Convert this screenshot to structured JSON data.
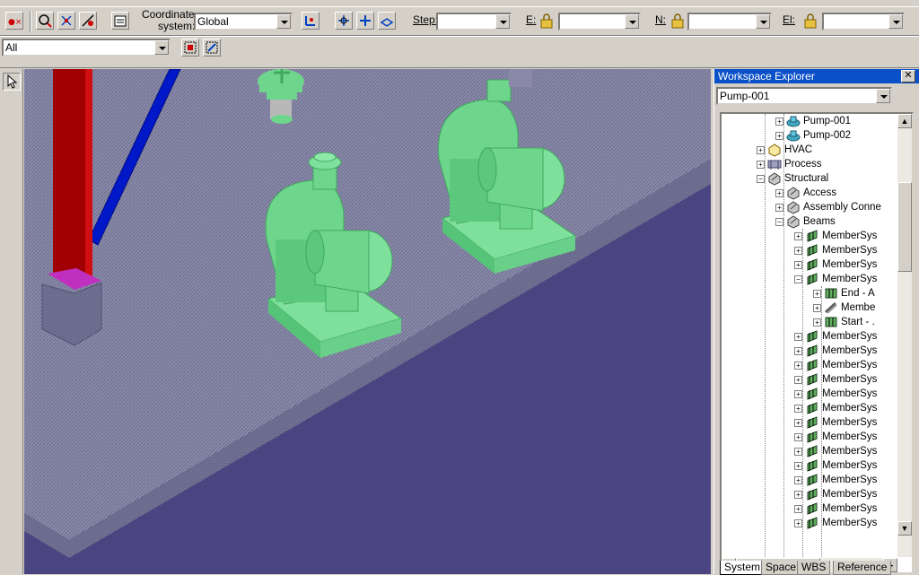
{
  "toolbar": {
    "coordinate_label_line1": "Coordinate",
    "coordinate_label_line2": "system:",
    "coordinate_value": "Global",
    "step_label": "Step:",
    "step_value": "",
    "e_label": "E:",
    "e_value": "",
    "n_label": "N:",
    "n_value": "",
    "el_label": "El:",
    "el_value": "",
    "filter_value": "All"
  },
  "explorer": {
    "title": "Workspace Explorer",
    "close": "✕",
    "selected": "Pump-001",
    "tree": [
      {
        "label": "Pump-001",
        "indent": 4,
        "expander": "+",
        "icon": "pump-icon"
      },
      {
        "label": "Pump-002",
        "indent": 4,
        "expander": "+",
        "icon": "pump-icon"
      },
      {
        "label": "HVAC",
        "indent": 3,
        "expander": "+",
        "icon": "hvac-icon"
      },
      {
        "label": "Process",
        "indent": 3,
        "expander": "+",
        "icon": "process-icon"
      },
      {
        "label": "Structural",
        "indent": 3,
        "expander": "−",
        "icon": "structural-icon"
      },
      {
        "label": "Access",
        "indent": 4,
        "expander": "+",
        "icon": "structural-icon"
      },
      {
        "label": "Assembly Conne",
        "indent": 4,
        "expander": "+",
        "icon": "structural-icon"
      },
      {
        "label": "Beams",
        "indent": 4,
        "expander": "−",
        "icon": "structural-icon"
      },
      {
        "label": "MemberSys",
        "indent": 5,
        "expander": "+",
        "icon": "member-icon"
      },
      {
        "label": "MemberSys",
        "indent": 5,
        "expander": "+",
        "icon": "member-icon"
      },
      {
        "label": "MemberSys",
        "indent": 5,
        "expander": "+",
        "icon": "member-icon"
      },
      {
        "label": "MemberSys",
        "indent": 5,
        "expander": "−",
        "icon": "member-icon"
      },
      {
        "label": "End - A",
        "indent": 6,
        "expander": "+",
        "icon": "end-icon"
      },
      {
        "label": "Membe",
        "indent": 6,
        "expander": "+",
        "icon": "member-part-icon"
      },
      {
        "label": "Start - .",
        "indent": 6,
        "expander": "+",
        "icon": "end-icon"
      },
      {
        "label": "MemberSys",
        "indent": 5,
        "expander": "+",
        "icon": "member-icon"
      },
      {
        "label": "MemberSys",
        "indent": 5,
        "expander": "+",
        "icon": "member-icon"
      },
      {
        "label": "MemberSys",
        "indent": 5,
        "expander": "+",
        "icon": "member-icon"
      },
      {
        "label": "MemberSys",
        "indent": 5,
        "expander": "+",
        "icon": "member-icon"
      },
      {
        "label": "MemberSys",
        "indent": 5,
        "expander": "+",
        "icon": "member-icon"
      },
      {
        "label": "MemberSys",
        "indent": 5,
        "expander": "+",
        "icon": "member-icon"
      },
      {
        "label": "MemberSys",
        "indent": 5,
        "expander": "+",
        "icon": "member-icon"
      },
      {
        "label": "MemberSys",
        "indent": 5,
        "expander": "+",
        "icon": "member-icon"
      },
      {
        "label": "MemberSys",
        "indent": 5,
        "expander": "+",
        "icon": "member-icon"
      },
      {
        "label": "MemberSys",
        "indent": 5,
        "expander": "+",
        "icon": "member-icon"
      },
      {
        "label": "MemberSys",
        "indent": 5,
        "expander": "+",
        "icon": "member-icon"
      },
      {
        "label": "MemberSys",
        "indent": 5,
        "expander": "+",
        "icon": "member-icon"
      },
      {
        "label": "MemberSys",
        "indent": 5,
        "expander": "+",
        "icon": "member-icon"
      },
      {
        "label": "MemberSys",
        "indent": 5,
        "expander": "+",
        "icon": "member-icon"
      }
    ],
    "tabs": [
      "System",
      "Space",
      "WBS",
      "Reference"
    ],
    "active_tab": "System"
  },
  "colors": {
    "deck": "#4a4580",
    "equipment": "#6ed68c",
    "column": "#a00000",
    "brace": "#0018c8",
    "title_bar": "#0a50c8"
  }
}
